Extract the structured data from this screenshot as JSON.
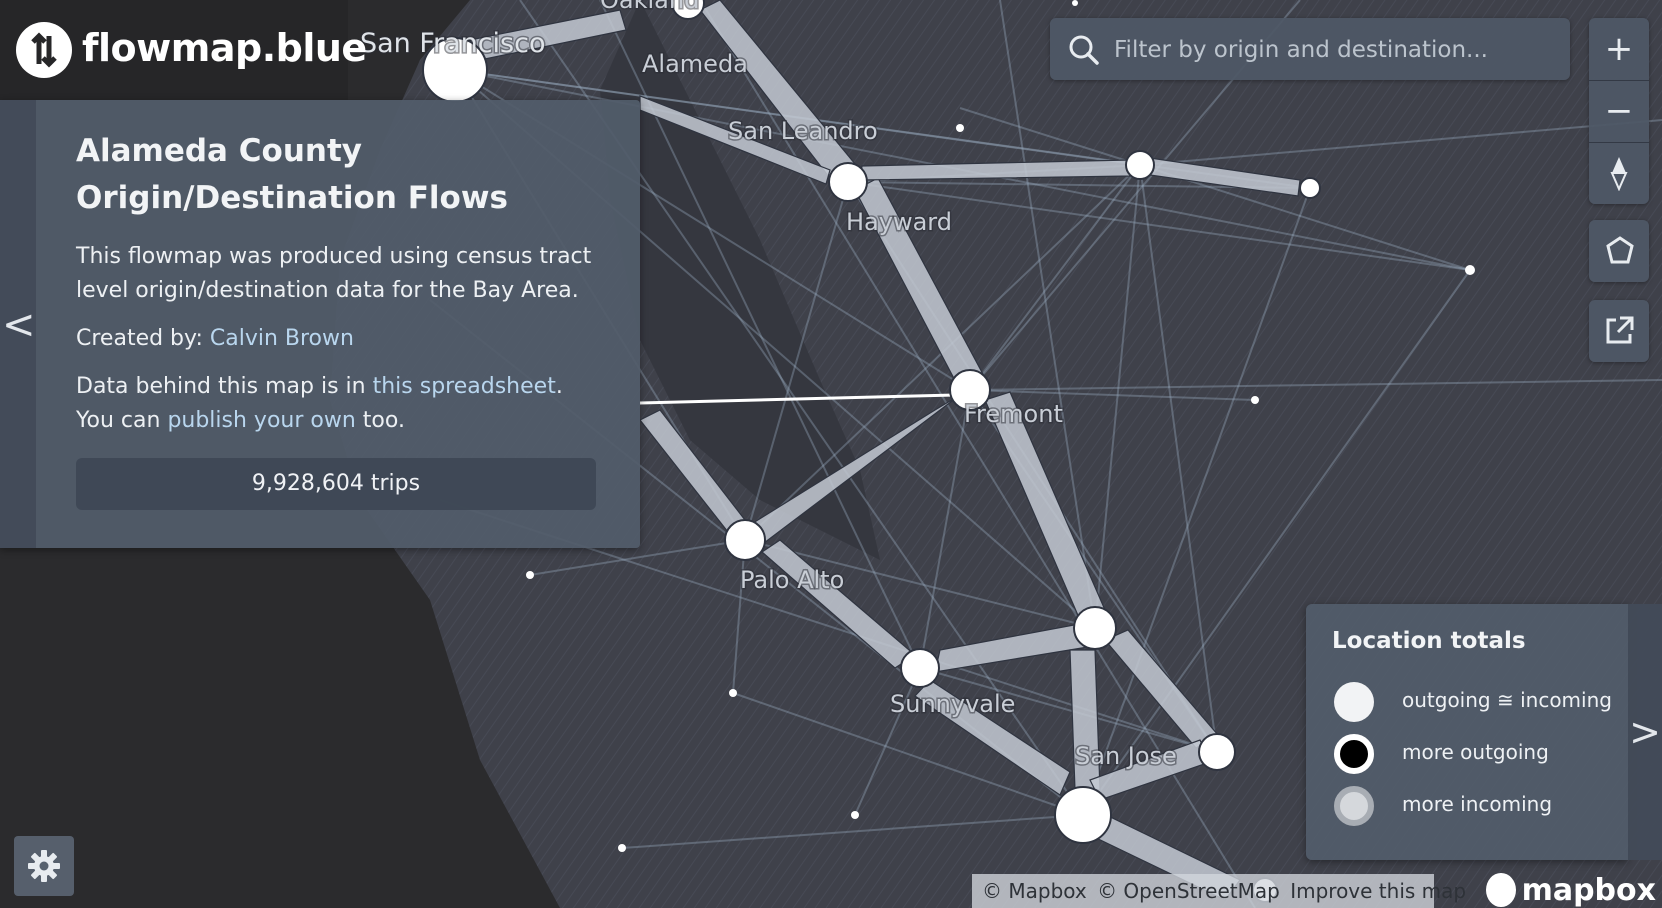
{
  "app": {
    "logo_text": "flowmap.blue"
  },
  "info_panel": {
    "collapse_arrow": "<",
    "title": "Alameda County Origin/Destination Flows",
    "description": "This flowmap was produced using census tract level origin/destination data for the Bay Area.",
    "created_by_label": "Created by:",
    "created_by_name": "Calvin Brown",
    "data_text_1": "Data behind this map is in",
    "data_link": "this spreadsheet",
    "data_text_2": ".",
    "publish_text_1": "You can",
    "publish_link": "publish your own",
    "publish_text_2": "too.",
    "trips": "9,928,604 trips"
  },
  "search": {
    "placeholder": "Filter by origin and destination..."
  },
  "map_controls": {
    "zoom_in": "+",
    "zoom_out": "−"
  },
  "map": {
    "cities": [
      {
        "name": "San Francisco"
      },
      {
        "name": "Alameda"
      },
      {
        "name": "San Leandro"
      },
      {
        "name": "Hayward"
      },
      {
        "name": "Fremont"
      },
      {
        "name": "Palo Alto"
      },
      {
        "name": "Sunnyvale"
      },
      {
        "name": "San Jose"
      },
      {
        "name": "Oakland"
      }
    ]
  },
  "legend": {
    "title": "Location totals",
    "items": [
      {
        "label": "outgoing ≅ incoming",
        "kind": "balanced"
      },
      {
        "label": "more outgoing",
        "kind": "outgoing"
      },
      {
        "label": "more incoming",
        "kind": "incoming"
      }
    ],
    "expand_arrow": ">"
  },
  "attribution": {
    "mapbox": "© Mapbox",
    "osm": "© OpenStreetMap",
    "improve": "Improve this map"
  },
  "mapbox_logo_text": "mapbox",
  "colors": {
    "land": "#3d3f48",
    "water": "#2b2b2d",
    "flow": "#c3c9d2",
    "panel": "#525c6a",
    "link": "#b9d6ee"
  }
}
